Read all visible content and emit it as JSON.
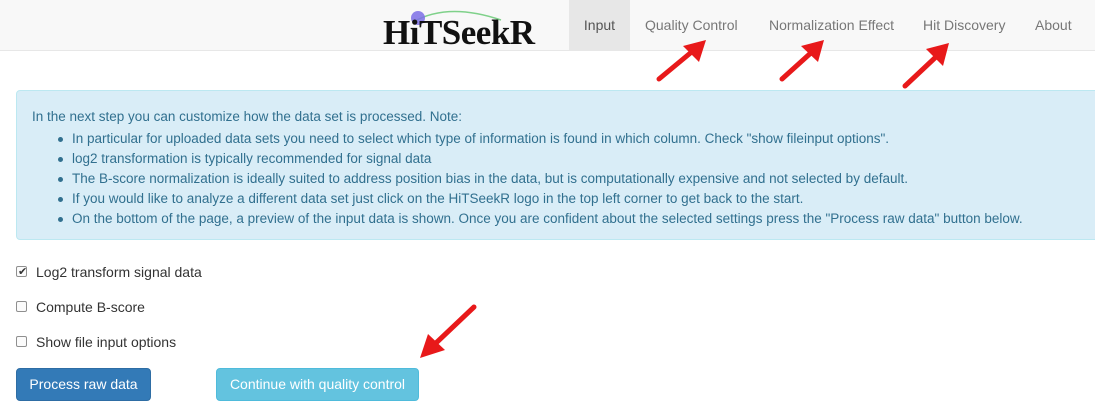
{
  "app": {
    "logo_text": "HiTSeekR"
  },
  "nav": {
    "tabs": [
      {
        "label": "Input",
        "active": true
      },
      {
        "label": "Quality Control",
        "active": false
      },
      {
        "label": "Normalization Effect",
        "active": false
      },
      {
        "label": "Hit Discovery",
        "active": false
      },
      {
        "label": "About",
        "active": false
      }
    ]
  },
  "info": {
    "intro": "In the next step you can customize how the data set is processed. Note:",
    "items": [
      "In particular for uploaded data sets you need to select which type of information is found in which column. Check \"show fileinput options\".",
      "log2 transformation is typically recommended for signal data",
      "The B-score normalization is ideally suited to address position bias in the data, but is computationally expensive and not selected by default.",
      "If you would like to analyze a different data set just click on the HiTSeekR logo in the top left corner to get back to the start.",
      "On the bottom of the page, a preview of the input data is shown. Once you are confident about the selected settings press the \"Process raw data\" button below."
    ]
  },
  "options": [
    {
      "label": "Log2 transform signal data",
      "checked": true
    },
    {
      "label": "Compute B-score",
      "checked": false
    },
    {
      "label": "Show file input options",
      "checked": false
    }
  ],
  "buttons": {
    "process": "Process raw data",
    "continue": "Continue with quality control"
  },
  "annotation": {
    "arrow_color": "#e8191a"
  },
  "colors": {
    "primary_button": "#337ab7",
    "info_button": "#5bc0de",
    "info_bg": "#d9edf7",
    "info_text": "#31708f"
  }
}
